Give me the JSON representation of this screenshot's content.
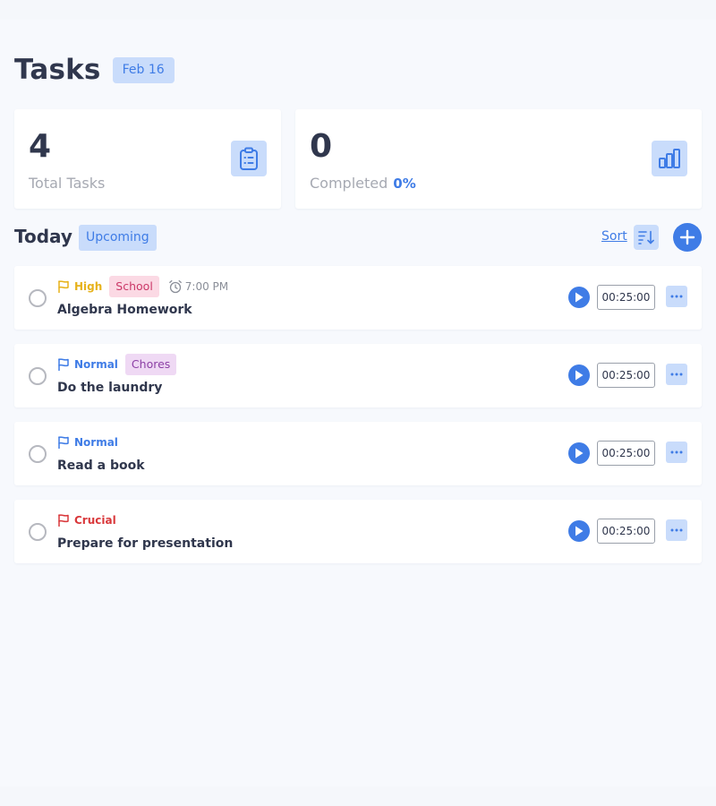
{
  "header": {
    "title": "Tasks",
    "date_badge": "Feb 16"
  },
  "stats": {
    "total": {
      "value": "4",
      "label": "Total Tasks",
      "icon": "clipboard-list-icon"
    },
    "completed": {
      "value": "0",
      "label": "Completed",
      "percent": "0%",
      "icon": "bar-chart-icon"
    }
  },
  "toolbar": {
    "section_title": "Today",
    "upcoming_tab": "Upcoming",
    "sort_label": "Sort",
    "sort_icon": "sort-descending-icon",
    "add_icon": "plus-icon"
  },
  "colors": {
    "accent": "#3f7ce6",
    "accent_light": "#c9dcfb",
    "priority_high": "#e7b21b",
    "priority_normal": "#3f7ce6",
    "priority_crucial": "#d9383b"
  },
  "tasks": [
    {
      "priority": "High",
      "tag": "School",
      "reminder": "7:00 PM",
      "title": "Algebra Homework",
      "timer": "00:25:00"
    },
    {
      "priority": "Normal",
      "tag": "Chores",
      "title": "Do the laundry",
      "timer": "00:25:00"
    },
    {
      "priority": "Normal",
      "title": "Read a book",
      "timer": "00:25:00"
    },
    {
      "priority": "Crucial",
      "title": "Prepare for presentation",
      "timer": "00:25:00"
    }
  ]
}
